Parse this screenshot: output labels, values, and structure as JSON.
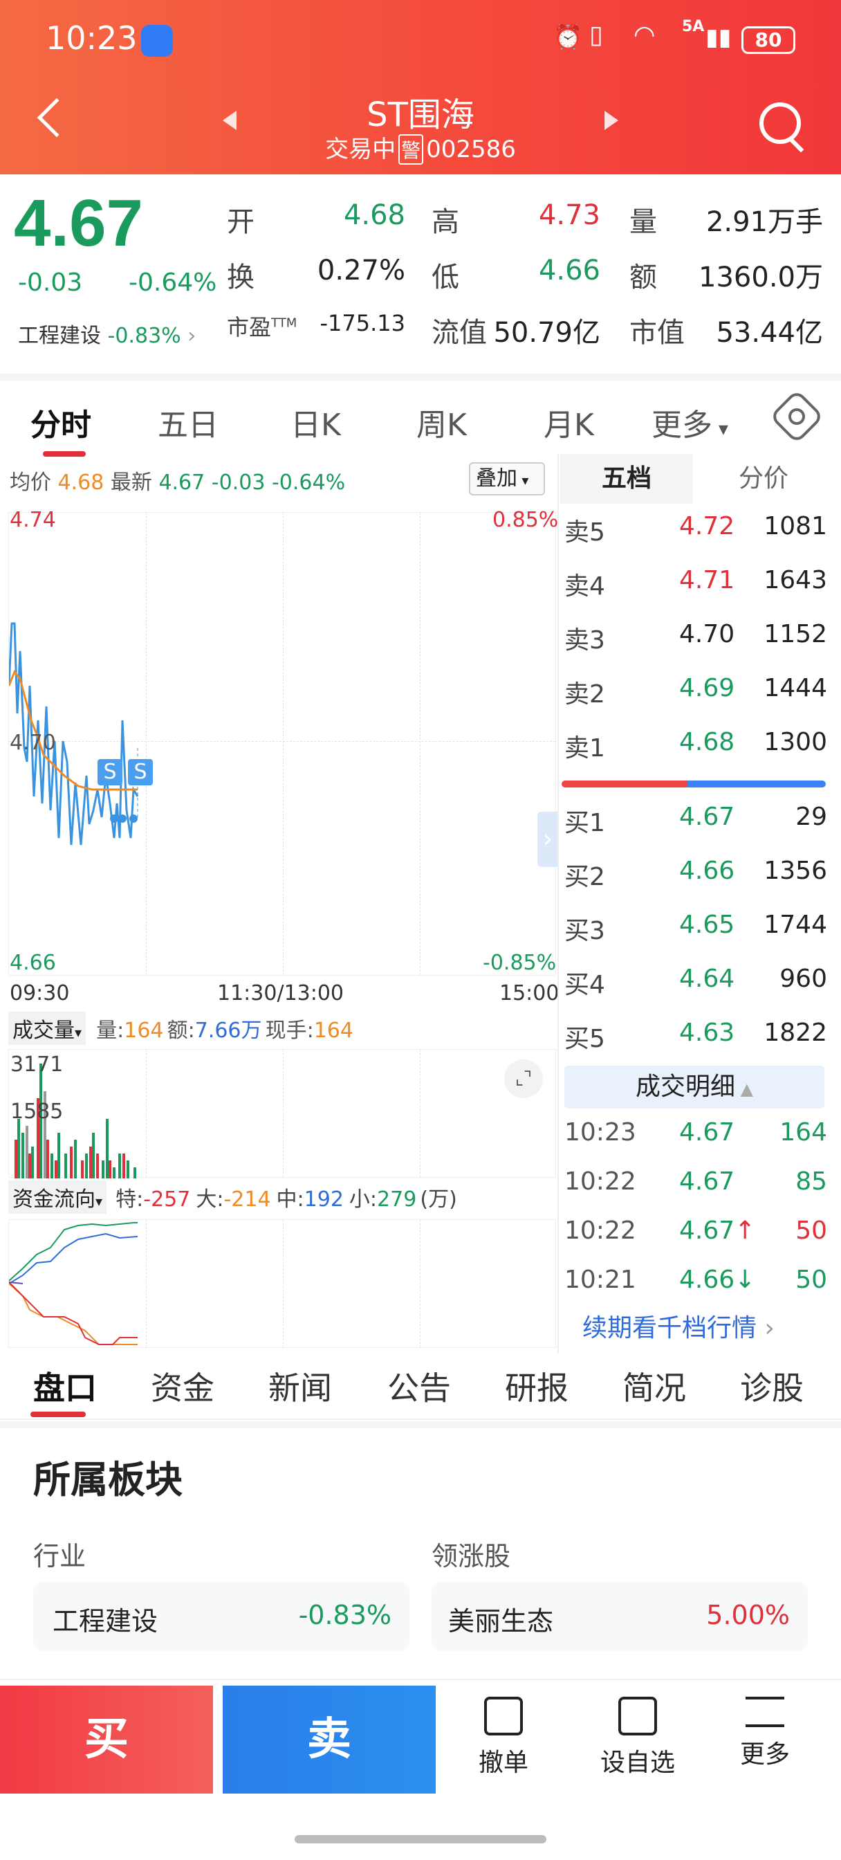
{
  "status": {
    "time": "10:23",
    "battery": "80",
    "network": "5A"
  },
  "header": {
    "title": "ST围海",
    "status": "交易中",
    "warn_badge": "警",
    "code": "002586"
  },
  "quote": {
    "price": "4.67",
    "change": "-0.03",
    "change_pct": "-0.64%",
    "sector_label": "工程建设",
    "sector_pct": "-0.83%",
    "rows": [
      [
        {
          "l": "开",
          "v": "4.68",
          "c": "green"
        },
        {
          "l": "高",
          "v": "4.73",
          "c": "red"
        },
        {
          "l": "量",
          "v": "2.91万手",
          "c": ""
        }
      ],
      [
        {
          "l": "换",
          "v": "0.27%",
          "c": ""
        },
        {
          "l": "低",
          "v": "4.66",
          "c": "green"
        },
        {
          "l": "额",
          "v": "1360.0万",
          "c": ""
        }
      ],
      [
        {
          "l": "市盈TTM",
          "v": "-175.13",
          "c": ""
        },
        {
          "l": "流值",
          "v": "50.79亿",
          "c": ""
        },
        {
          "l": "市值",
          "v": "53.44亿",
          "c": ""
        }
      ]
    ]
  },
  "tabs": {
    "items": [
      "分时",
      "五日",
      "日K",
      "周K",
      "月K",
      "更多"
    ],
    "active": 0
  },
  "chart_info": {
    "avg_label": "均价",
    "avg_val": "4.68",
    "last_label": "最新",
    "last_val": "4.67",
    "chg": "-0.03",
    "chg_pct": "-0.64%",
    "overlay_btn": "叠加",
    "y_top": "4.74",
    "y_mid": "4.70",
    "y_bot": "4.66",
    "pct_top": "0.85%",
    "pct_bot": "-0.85%",
    "t_start": "09:30",
    "t_mid": "11:30/13:00",
    "t_end": "15:00",
    "s_badge": "S"
  },
  "volume": {
    "selector": "成交量",
    "vol_label": "量:",
    "vol_val": "164",
    "amt_label": "额:",
    "amt_val": "7.66万",
    "now_label": "现手:",
    "now_val": "164",
    "y_top": "3171",
    "y_mid": "1585"
  },
  "flow": {
    "selector": "资金流向",
    "items": [
      {
        "l": "特:",
        "v": "-257",
        "c": "#e0303a"
      },
      {
        "l": "大:",
        "v": "-214",
        "c": "#f08a24"
      },
      {
        "l": "中:",
        "v": "192",
        "c": "#2f6cd8"
      },
      {
        "l": "小:",
        "v": "279",
        "c": "#1a9b5d"
      }
    ],
    "unit": "(万)"
  },
  "orderbook": {
    "tab_five": "五档",
    "tab_split": "分价",
    "sells": [
      {
        "l": "卖5",
        "p": "4.72",
        "v": "1081",
        "c": "red"
      },
      {
        "l": "卖4",
        "p": "4.71",
        "v": "1643",
        "c": "red"
      },
      {
        "l": "卖3",
        "p": "4.70",
        "v": "1152",
        "c": ""
      },
      {
        "l": "卖2",
        "p": "4.69",
        "v": "1444",
        "c": "green"
      },
      {
        "l": "卖1",
        "p": "4.68",
        "v": "1300",
        "c": "green"
      }
    ],
    "buys": [
      {
        "l": "买1",
        "p": "4.67",
        "v": "29",
        "c": "green"
      },
      {
        "l": "买2",
        "p": "4.66",
        "v": "1356",
        "c": "green"
      },
      {
        "l": "买3",
        "p": "4.65",
        "v": "1744",
        "c": "green"
      },
      {
        "l": "买4",
        "p": "4.64",
        "v": "960",
        "c": "green"
      },
      {
        "l": "买5",
        "p": "4.63",
        "v": "1822",
        "c": "green"
      }
    ],
    "trade_title": "成交明细",
    "trades": [
      {
        "t": "10:23",
        "p": "4.67",
        "arrow": "",
        "v": "164",
        "vc": "green"
      },
      {
        "t": "10:22",
        "p": "4.67",
        "arrow": "",
        "v": "85",
        "vc": "green"
      },
      {
        "t": "10:22",
        "p": "4.67",
        "arrow": "↑",
        "v": "50",
        "vc": "red"
      },
      {
        "t": "10:21",
        "p": "4.66",
        "arrow": "↓",
        "v": "50",
        "vc": "green"
      }
    ],
    "more_link": "续期看千档行情"
  },
  "bottom_tabs": {
    "items": [
      "盘口",
      "资金",
      "新闻",
      "公告",
      "研报",
      "简况",
      "诊股"
    ],
    "active": 0
  },
  "sector": {
    "title": "所属板块",
    "industry_label": "行业",
    "leader_label": "领涨股",
    "industry_name": "工程建设",
    "industry_pct": "-0.83%",
    "leader_name": "美丽生态",
    "leader_pct": "5.00%"
  },
  "actions": {
    "buy": "买",
    "sell": "卖",
    "cancel": "撤单",
    "watch": "设自选",
    "more": "更多"
  }
}
